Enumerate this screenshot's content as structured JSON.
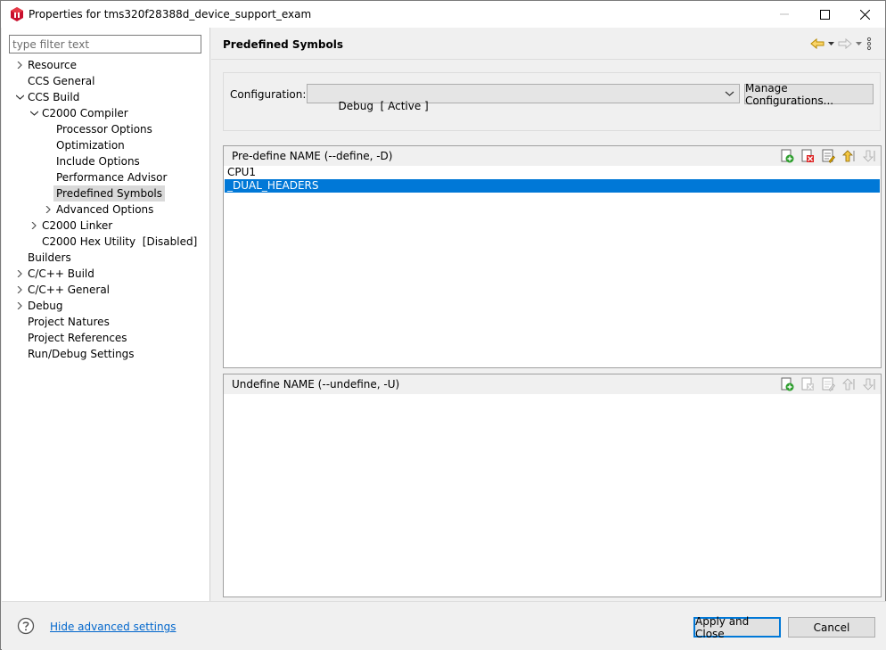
{
  "window": {
    "title": "Properties for tms320f28388d_device_support_exam"
  },
  "filter": {
    "placeholder": "type filter text"
  },
  "tree": {
    "items": [
      {
        "label": "Resource",
        "expander": "collapsed"
      },
      {
        "label": "CCS General",
        "expander": "none"
      },
      {
        "label": "CCS Build",
        "expander": "expanded"
      },
      {
        "label": "C2000 Compiler",
        "expander": "expanded"
      },
      {
        "label": "Processor Options",
        "expander": "none"
      },
      {
        "label": "Optimization",
        "expander": "none"
      },
      {
        "label": "Include Options",
        "expander": "none"
      },
      {
        "label": "Performance Advisor",
        "expander": "none"
      },
      {
        "label": "Predefined Symbols",
        "expander": "none",
        "selected": true
      },
      {
        "label": "Advanced Options",
        "expander": "collapsed"
      },
      {
        "label": "C2000 Linker",
        "expander": "collapsed"
      },
      {
        "label": "C2000 Hex Utility  [Disabled]",
        "expander": "none"
      },
      {
        "label": "Builders",
        "expander": "none"
      },
      {
        "label": "C/C++ Build",
        "expander": "collapsed"
      },
      {
        "label": "C/C++ General",
        "expander": "collapsed"
      },
      {
        "label": "Debug",
        "expander": "collapsed"
      },
      {
        "label": "Project Natures",
        "expander": "none"
      },
      {
        "label": "Project References",
        "expander": "none"
      },
      {
        "label": "Run/Debug Settings",
        "expander": "none"
      }
    ]
  },
  "page": {
    "title": "Predefined Symbols"
  },
  "configuration": {
    "label": "Configuration:",
    "value": "Debug  [ Active ]",
    "manage_label": "Manage Configurations..."
  },
  "predefine": {
    "header": "Pre-define NAME (--define, -D)",
    "rows": [
      "CPU1",
      "_DUAL_HEADERS"
    ],
    "selected_index": 1
  },
  "undefine": {
    "header": "Undefine NAME (--undefine, -U)",
    "rows": []
  },
  "footer": {
    "help_link": "Hide advanced settings",
    "apply_label": "Apply and Close",
    "cancel_label": "Cancel"
  },
  "colors": {
    "selection": "#0078d7",
    "link": "#0066cc",
    "tree_selection": "#d9d9d9"
  }
}
